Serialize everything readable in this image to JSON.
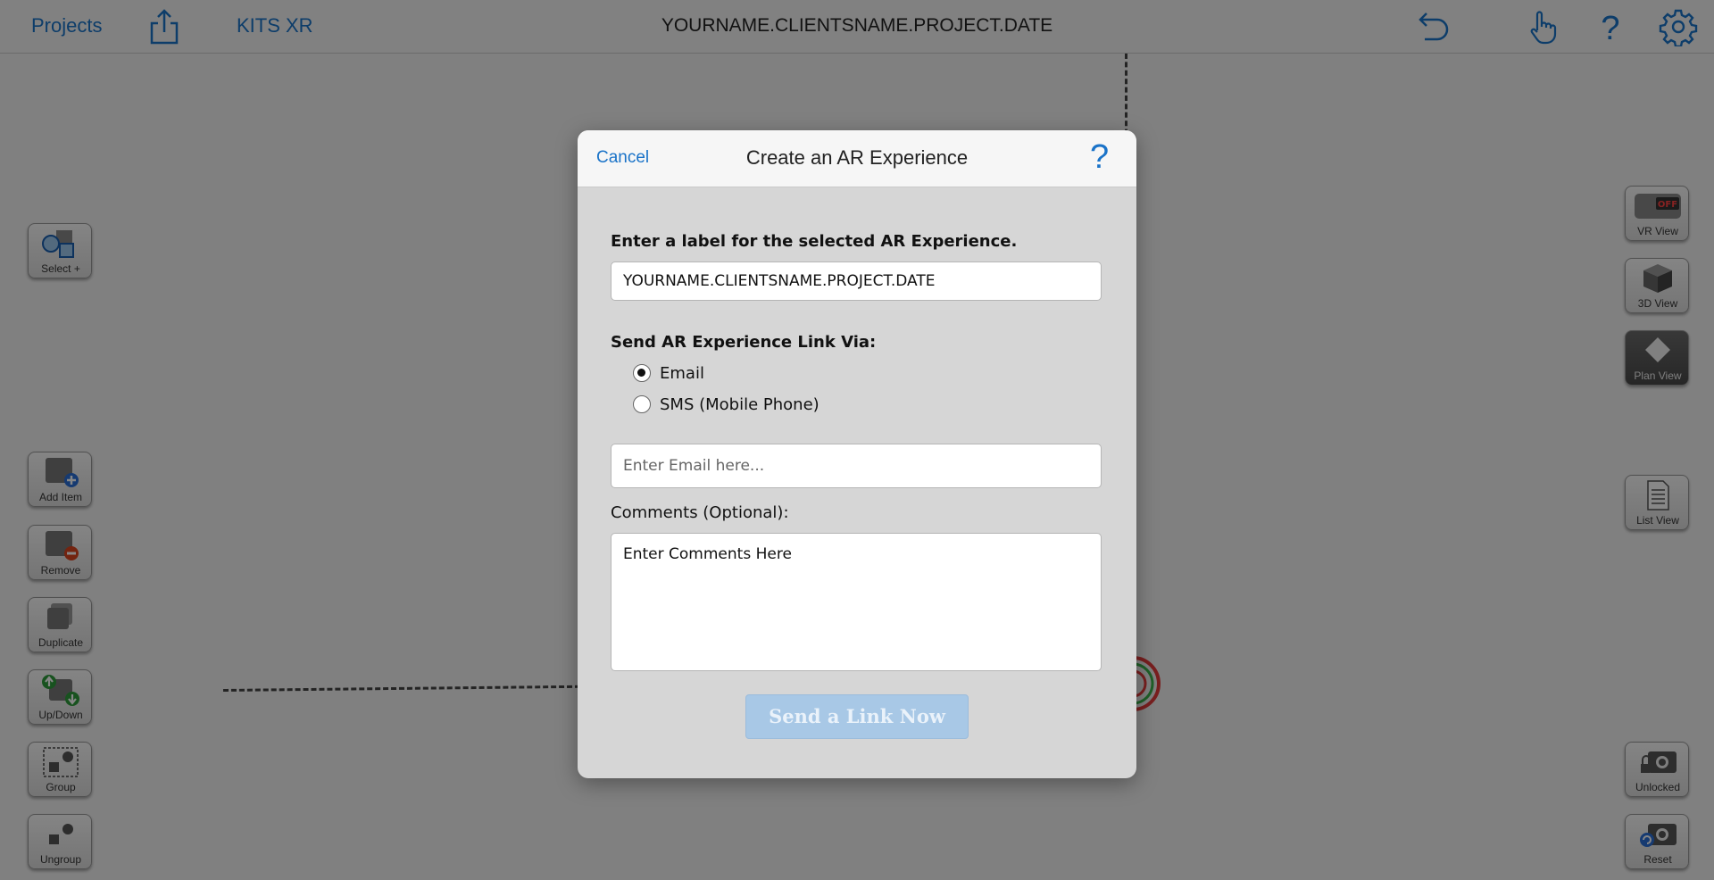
{
  "topbar": {
    "projects_label": "Projects",
    "app_label": "KITS XR",
    "document_title": "YOURNAME.CLIENTSNAME.PROJECT.DATE",
    "icons": [
      "share-icon",
      "undo-icon",
      "hand-pointer-icon",
      "help-icon",
      "gear-icon"
    ]
  },
  "left_tools": [
    {
      "label": "Select +",
      "icon": "select-shapes-icon"
    },
    {
      "label": "Add Item",
      "icon": "add-item-icon"
    },
    {
      "label": "Remove",
      "icon": "remove-item-icon"
    },
    {
      "label": "Duplicate",
      "icon": "duplicate-icon"
    },
    {
      "label": "Up/Down",
      "icon": "up-down-icon"
    },
    {
      "label": "Group",
      "icon": "group-icon"
    },
    {
      "label": "Ungroup",
      "icon": "ungroup-icon"
    }
  ],
  "right_tools": [
    {
      "label": "VR View",
      "badge": "OFF",
      "icon": "vr-headset-icon"
    },
    {
      "label": "3D View",
      "icon": "cube-icon"
    },
    {
      "label": "Plan View",
      "icon": "plan-icon"
    },
    {
      "label": "List View",
      "icon": "document-list-icon"
    },
    {
      "label": "Unlocked",
      "icon": "camera-unlocked-icon"
    },
    {
      "label": "Reset",
      "icon": "camera-reset-icon"
    }
  ],
  "dialog": {
    "cancel_label": "Cancel",
    "title": "Create an AR Experience",
    "help_glyph": "?",
    "label_prompt": "Enter a label for the selected AR Experience.",
    "label_value": "YOURNAME.CLIENTSNAME.PROJECT.DATE",
    "send_via_label": "Send AR Experience Link Via:",
    "options": [
      {
        "label": "Email",
        "selected": true
      },
      {
        "label": "SMS (Mobile Phone)",
        "selected": false
      }
    ],
    "email_placeholder": "Enter Email here...",
    "comments_label": "Comments (Optional):",
    "comments_placeholder": "Enter Comments Here",
    "send_label": "Send a Link Now"
  },
  "colors": {
    "accent": "#1a73c8",
    "send_button_disabled": "#a8c8e6",
    "overlay": "rgba(0,0,0,0.47)"
  }
}
